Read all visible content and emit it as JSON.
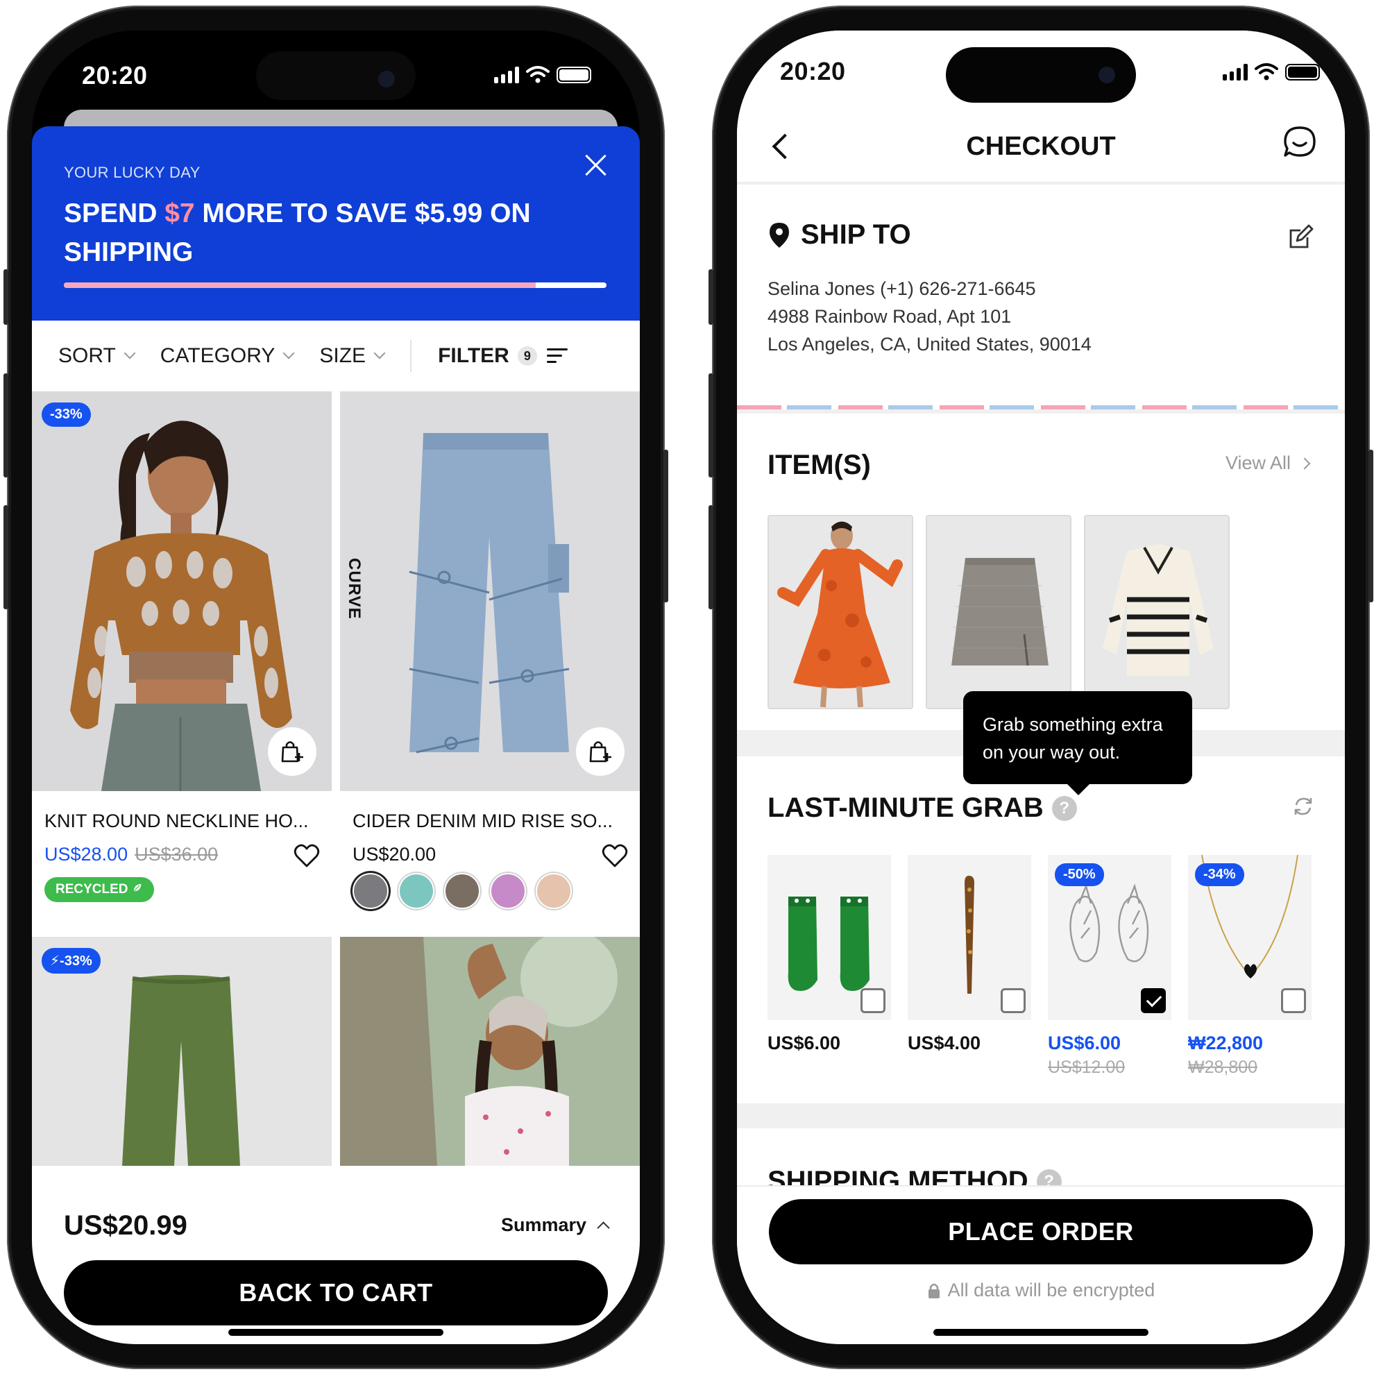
{
  "left": {
    "status": {
      "time": "20:20"
    },
    "promo": {
      "eyebrow": "YOUR LUCKY DAY",
      "headline_pre": "SPEND ",
      "headline_hl": "$7",
      "headline_post": " MORE TO SAVE $5.99 ON SHIPPING",
      "progress_percent": 87,
      "highlight_color": "#ff8da3",
      "bg_color": "#0f3fd6"
    },
    "sort": {
      "sort_label": "SORT",
      "category_label": "CATEGORY",
      "size_label": "SIZE",
      "filter_label": "FILTER",
      "filter_count": "9"
    },
    "products": [
      {
        "badge": "-33%",
        "title": "KNIT ROUND NECKLINE HO...",
        "price": "US$28.00",
        "original": "US$36.00",
        "tag": "RECYCLED"
      },
      {
        "side_label": "CURVE",
        "title": "CIDER DENIM MID RISE SO...",
        "price": "US$20.00",
        "swatches": [
          "#7b7b7f",
          "#7cc6c0",
          "#7a6e62",
          "#c58ac7",
          "#e6c3ad"
        ]
      },
      {
        "badge": "-33%"
      },
      {}
    ],
    "footer": {
      "total": "US$20.99",
      "summary_label": "Summary",
      "cta": "BACK TO CART"
    }
  },
  "right": {
    "status": {
      "time": "20:20"
    },
    "nav": {
      "title": "CHECKOUT"
    },
    "ship_to": {
      "heading": "SHIP TO",
      "name_phone": "Selina Jones (+1) 626-271-6645",
      "street": "4988 Rainbow Road, Apt 101",
      "city": "Los Angeles, CA, United States, 90014"
    },
    "items": {
      "heading": "ITEM(S)",
      "view_all": "View All"
    },
    "tooltip": {
      "line1": "Grab something extra",
      "line2": "on your way out."
    },
    "last_minute": {
      "heading": "LAST-MINUTE GRAB",
      "products": [
        {
          "price": "US$6.00",
          "checked": false
        },
        {
          "price": "US$4.00",
          "checked": false
        },
        {
          "badge": "-50%",
          "price": "US$6.00",
          "original": "US$12.00",
          "checked": true
        },
        {
          "badge": "-34%",
          "price": "₩22,800",
          "original": "₩28,800",
          "checked": false
        }
      ]
    },
    "shipping_method": {
      "heading": "SHIPPING METHOD"
    },
    "footer": {
      "cta": "PLACE ORDER",
      "encrypted_note": "All data will be encrypted"
    },
    "accent_color": "#1652f0"
  }
}
